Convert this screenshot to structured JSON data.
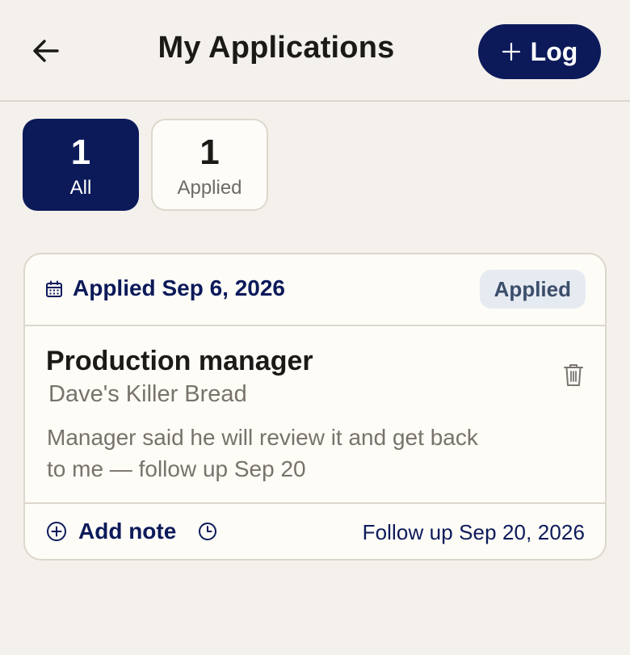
{
  "header": {
    "title": "My Applications",
    "log_button_label": "Log",
    "back_icon": "arrow-left-icon",
    "log_icon": "plus-icon"
  },
  "filters": [
    {
      "count": "1",
      "label": "All",
      "active": true
    },
    {
      "count": "1",
      "label": "Applied",
      "active": false
    }
  ],
  "application": {
    "applied_date": "Applied Sep 6, 2026",
    "status": "Applied",
    "job_title": "Production manager",
    "company": "Dave's Killer Bread",
    "note": "Manager said he will review it and get back to me — follow up Sep 20",
    "add_note_label": "Add note",
    "follow_up": "Follow up Sep 20, 2026"
  },
  "colors": {
    "primary": "#0c1a5a",
    "background": "#f4f1ec",
    "card": "#fdfcf7",
    "badge_bg": "#e6ebf2",
    "muted_text": "#78726b"
  }
}
